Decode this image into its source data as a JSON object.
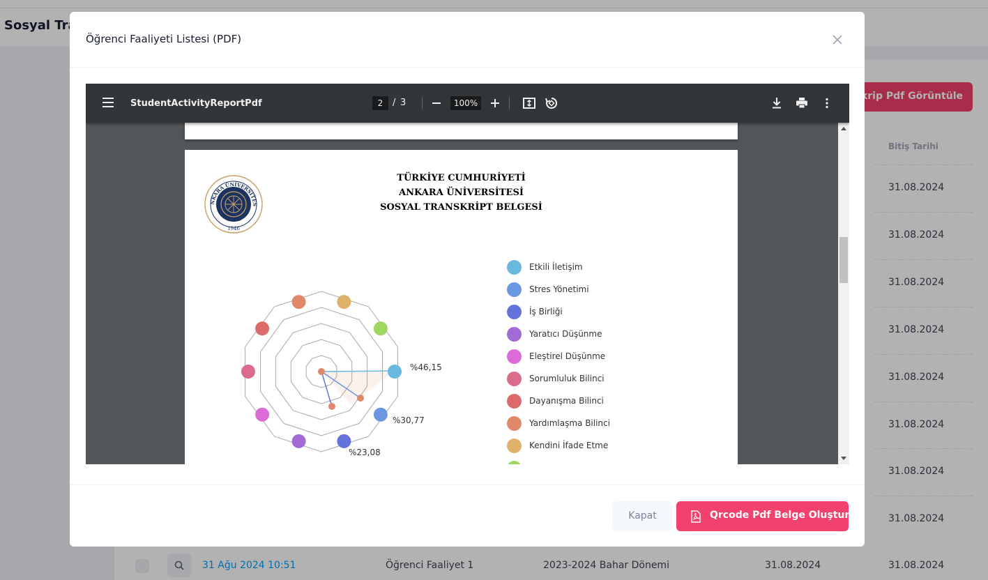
{
  "background": {
    "page_title": "Sosyal Tran",
    "action_button_label": "Transkrip Pdf Görüntüle",
    "column_header": "Bitiş Tarihi",
    "end_dates": [
      "31.08.2024",
      "31.08.2024",
      "31.08.2024",
      "31.08.2024",
      "31.08.2024",
      "31.08.2024",
      "31.08.2024",
      "31.08.2024"
    ],
    "last_row": {
      "created": "31 Ağu 2024 10:51",
      "activity": "Öğrenci Faaliyet 1",
      "term": "2023-2024 Bahar Dönemi",
      "start_date": "31.08.2024",
      "end_date": "31.08.2024"
    },
    "accent_color": "#f1416c"
  },
  "modal": {
    "title": "Öğrenci Faaliyeti Listesi (PDF)",
    "close_label": "Kapat",
    "generate_label": "Qrcode Pdf Belge Oluştur"
  },
  "viewer": {
    "doc_name": "StudentActivityReportPdf",
    "current_page": "2",
    "page_separator": "/",
    "total_pages": "3",
    "zoom": "100%",
    "icons": [
      "menu-icon",
      "zoom-out-icon",
      "zoom-in-icon",
      "fit-page-icon",
      "rotate-icon",
      "download-icon",
      "print-icon",
      "more-icon"
    ]
  },
  "document": {
    "heading_lines": [
      "TÜRKİYE CUMHURİYETİ",
      "ANKARA ÜNİVERSİTESİ",
      "SOSYAL TRANSKRİPT BELGESİ"
    ],
    "seal_text": "ANKARA ÜNİVERSİTESİ",
    "seal_year": "1946",
    "radar_labels": [
      "%46,15",
      "%30,77",
      "%23,08"
    ],
    "legend": [
      {
        "label": "Etkili İletişim",
        "color": "#6ab8de"
      },
      {
        "label": "Stres Yönetimi",
        "color": "#6b96e2"
      },
      {
        "label": "İş Birliği",
        "color": "#6472dc"
      },
      {
        "label": "Yaratıcı Düşünme",
        "color": "#a26ad6"
      },
      {
        "label": "Eleştirel Düşünme",
        "color": "#dc6ad7"
      },
      {
        "label": "Sorumluluk Bilinci",
        "color": "#dc6a8a"
      },
      {
        "label": "Dayanışma Bilinci",
        "color": "#dc6a6a"
      },
      {
        "label": "Yardımlaşma Bilinci",
        "color": "#e0896a"
      },
      {
        "label": "Kendini İfade Etme",
        "color": "#e0b16a"
      },
      {
        "label": "",
        "color": "#9ed65f"
      }
    ]
  }
}
